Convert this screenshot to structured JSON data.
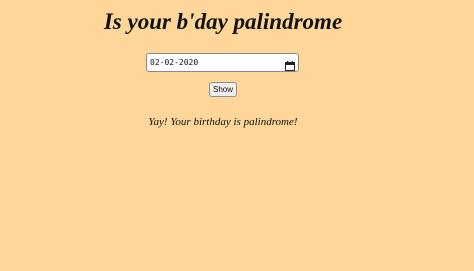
{
  "page": {
    "title": "Is your b'day palindrome",
    "background_color": "#ffd699"
  },
  "date_input": {
    "value": "02-02-2020",
    "icon": "calendar-icon"
  },
  "show_button": {
    "label": "Show"
  },
  "result": {
    "message": "Yay! Your birthday is palindrome!"
  }
}
